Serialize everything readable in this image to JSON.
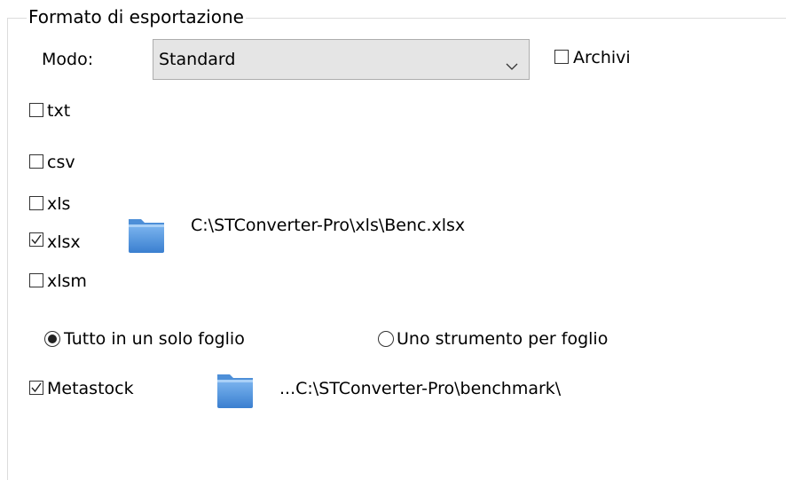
{
  "group": {
    "title": "Formato di esportazione"
  },
  "mode": {
    "label": "Modo:",
    "selected": "Standard",
    "archivi_label": "Archivi",
    "archivi_checked": false
  },
  "formats": {
    "txt": {
      "label": "txt",
      "checked": false
    },
    "csv": {
      "label": "csv",
      "checked": false
    },
    "xls": {
      "label": "xls",
      "checked": false
    },
    "xlsx": {
      "label": "xlsx",
      "checked": true
    },
    "xlsm": {
      "label": "xlsm",
      "checked": false
    }
  },
  "excel_path": "C:\\STConverter-Pro\\xls\\Benc.xlsx",
  "sheet_mode": {
    "option_all": {
      "label": "Tutto in un solo foglio",
      "selected": true
    },
    "option_each": {
      "label": "Uno strumento per foglio",
      "selected": false
    }
  },
  "metastock": {
    "label": "Metastock",
    "checked": true,
    "path": "...C:\\STConverter-Pro\\benchmark\\"
  },
  "icons": {
    "folder": "folder-icon",
    "dropdown": "chevron-down-icon",
    "check": "check-icon"
  }
}
